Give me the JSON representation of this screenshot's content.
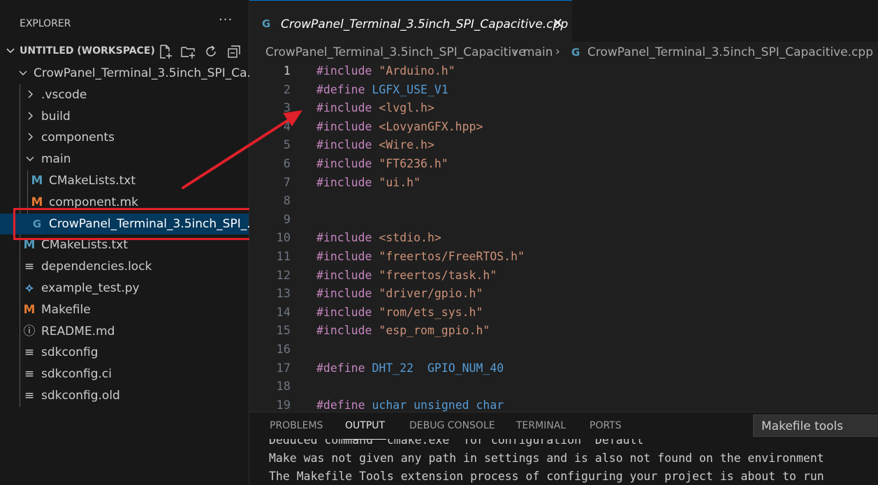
{
  "sidebar": {
    "title": "EXPLORER",
    "more": "···",
    "workspace": "UNTITLED (WORKSPACE)",
    "tree": [
      {
        "label": "CrowPanel_Terminal_3.5inch_SPI_Ca...",
        "kind": "folder-open",
        "depth": 1
      },
      {
        "label": ".vscode",
        "kind": "folder",
        "depth": 2
      },
      {
        "label": "build",
        "kind": "folder",
        "depth": 2
      },
      {
        "label": "components",
        "kind": "folder",
        "depth": 2
      },
      {
        "label": "main",
        "kind": "folder-open",
        "depth": 2
      },
      {
        "label": "CMakeLists.txt",
        "kind": "cmake",
        "depth": 3
      },
      {
        "label": "component.mk",
        "kind": "make",
        "depth": 3
      },
      {
        "label": "CrowPanel_Terminal_3.5inch_SPI_...",
        "kind": "cpp",
        "depth": 3,
        "selected": true
      },
      {
        "label": "CMakeLists.txt",
        "kind": "cmake",
        "depth": 2
      },
      {
        "label": "dependencies.lock",
        "kind": "lines",
        "depth": 2
      },
      {
        "label": "example_test.py",
        "kind": "python",
        "depth": 2
      },
      {
        "label": "Makefile",
        "kind": "make",
        "depth": 2
      },
      {
        "label": "README.md",
        "kind": "info",
        "depth": 2
      },
      {
        "label": "sdkconfig",
        "kind": "lines",
        "depth": 2
      },
      {
        "label": "sdkconfig.ci",
        "kind": "lines",
        "depth": 2
      },
      {
        "label": "sdkconfig.old",
        "kind": "lines",
        "depth": 2
      }
    ]
  },
  "editor": {
    "tab_label": "CrowPanel_Terminal_3.5inch_SPI_Capacitive.cpp",
    "tab_close": "✕",
    "breadcrumb": [
      "CrowPanel_Terminal_3.5inch_SPI_Capacitive",
      "main",
      "CrowPanel_Terminal_3.5inch_SPI_Capacitive.cpp"
    ],
    "lines": [
      {
        "n": "1",
        "parts": [
          [
            "kw",
            "#include "
          ],
          [
            "st",
            "\"Arduino.h\""
          ]
        ]
      },
      {
        "n": "2",
        "parts": [
          [
            "kw",
            "#define "
          ],
          [
            "mc",
            "LGFX_USE_V1"
          ]
        ]
      },
      {
        "n": "3",
        "parts": [
          [
            "kw",
            "#include "
          ],
          [
            "st",
            "<lvgl.h>"
          ]
        ]
      },
      {
        "n": "4",
        "parts": [
          [
            "kw",
            "#include "
          ],
          [
            "st",
            "<LovyanGFX.hpp>"
          ]
        ]
      },
      {
        "n": "5",
        "parts": [
          [
            "kw",
            "#include "
          ],
          [
            "st",
            "<Wire.h>"
          ]
        ]
      },
      {
        "n": "6",
        "parts": [
          [
            "kw",
            "#include "
          ],
          [
            "st",
            "\"FT6236.h\""
          ]
        ]
      },
      {
        "n": "7",
        "parts": [
          [
            "kw",
            "#include "
          ],
          [
            "st",
            "\"ui.h\""
          ]
        ]
      },
      {
        "n": "8",
        "parts": []
      },
      {
        "n": "9",
        "parts": []
      },
      {
        "n": "10",
        "parts": [
          [
            "kw",
            "#include "
          ],
          [
            "st",
            "<stdio.h>"
          ]
        ]
      },
      {
        "n": "11",
        "parts": [
          [
            "kw",
            "#include "
          ],
          [
            "st",
            "\"freertos/FreeRTOS.h\""
          ]
        ]
      },
      {
        "n": "12",
        "parts": [
          [
            "kw",
            "#include "
          ],
          [
            "st",
            "\"freertos/task.h\""
          ]
        ]
      },
      {
        "n": "13",
        "parts": [
          [
            "kw",
            "#include "
          ],
          [
            "st",
            "\"driver/gpio.h\""
          ]
        ]
      },
      {
        "n": "14",
        "parts": [
          [
            "kw",
            "#include "
          ],
          [
            "st",
            "\"rom/ets_sys.h\""
          ]
        ]
      },
      {
        "n": "15",
        "parts": [
          [
            "kw",
            "#include "
          ],
          [
            "st",
            "\"esp_rom_gpio.h\""
          ]
        ]
      },
      {
        "n": "16",
        "parts": []
      },
      {
        "n": "17",
        "parts": [
          [
            "kw",
            "#define "
          ],
          [
            "mc",
            "DHT_22  GPIO_NUM_40"
          ]
        ]
      },
      {
        "n": "18",
        "parts": []
      },
      {
        "n": "19",
        "parts": [
          [
            "kw",
            "#define "
          ],
          [
            "mc",
            "uchar unsigned char"
          ]
        ]
      }
    ]
  },
  "panel": {
    "tabs": [
      "PROBLEMS",
      "OUTPUT",
      "DEBUG CONSOLE",
      "TERMINAL",
      "PORTS"
    ],
    "active_tab": "OUTPUT",
    "output_source": "Makefile tools",
    "output_lines": [
      "Deduced command 'cmake.exe' for configuration 'Default'",
      "Make was not given any path in settings and is also not found on the environment",
      "The Makefile Tools extension process of configuring your project is about to run"
    ]
  },
  "colors": {
    "selection_box": "#e0202a",
    "arrow": "#e0202a",
    "accent": "#0078d4"
  }
}
